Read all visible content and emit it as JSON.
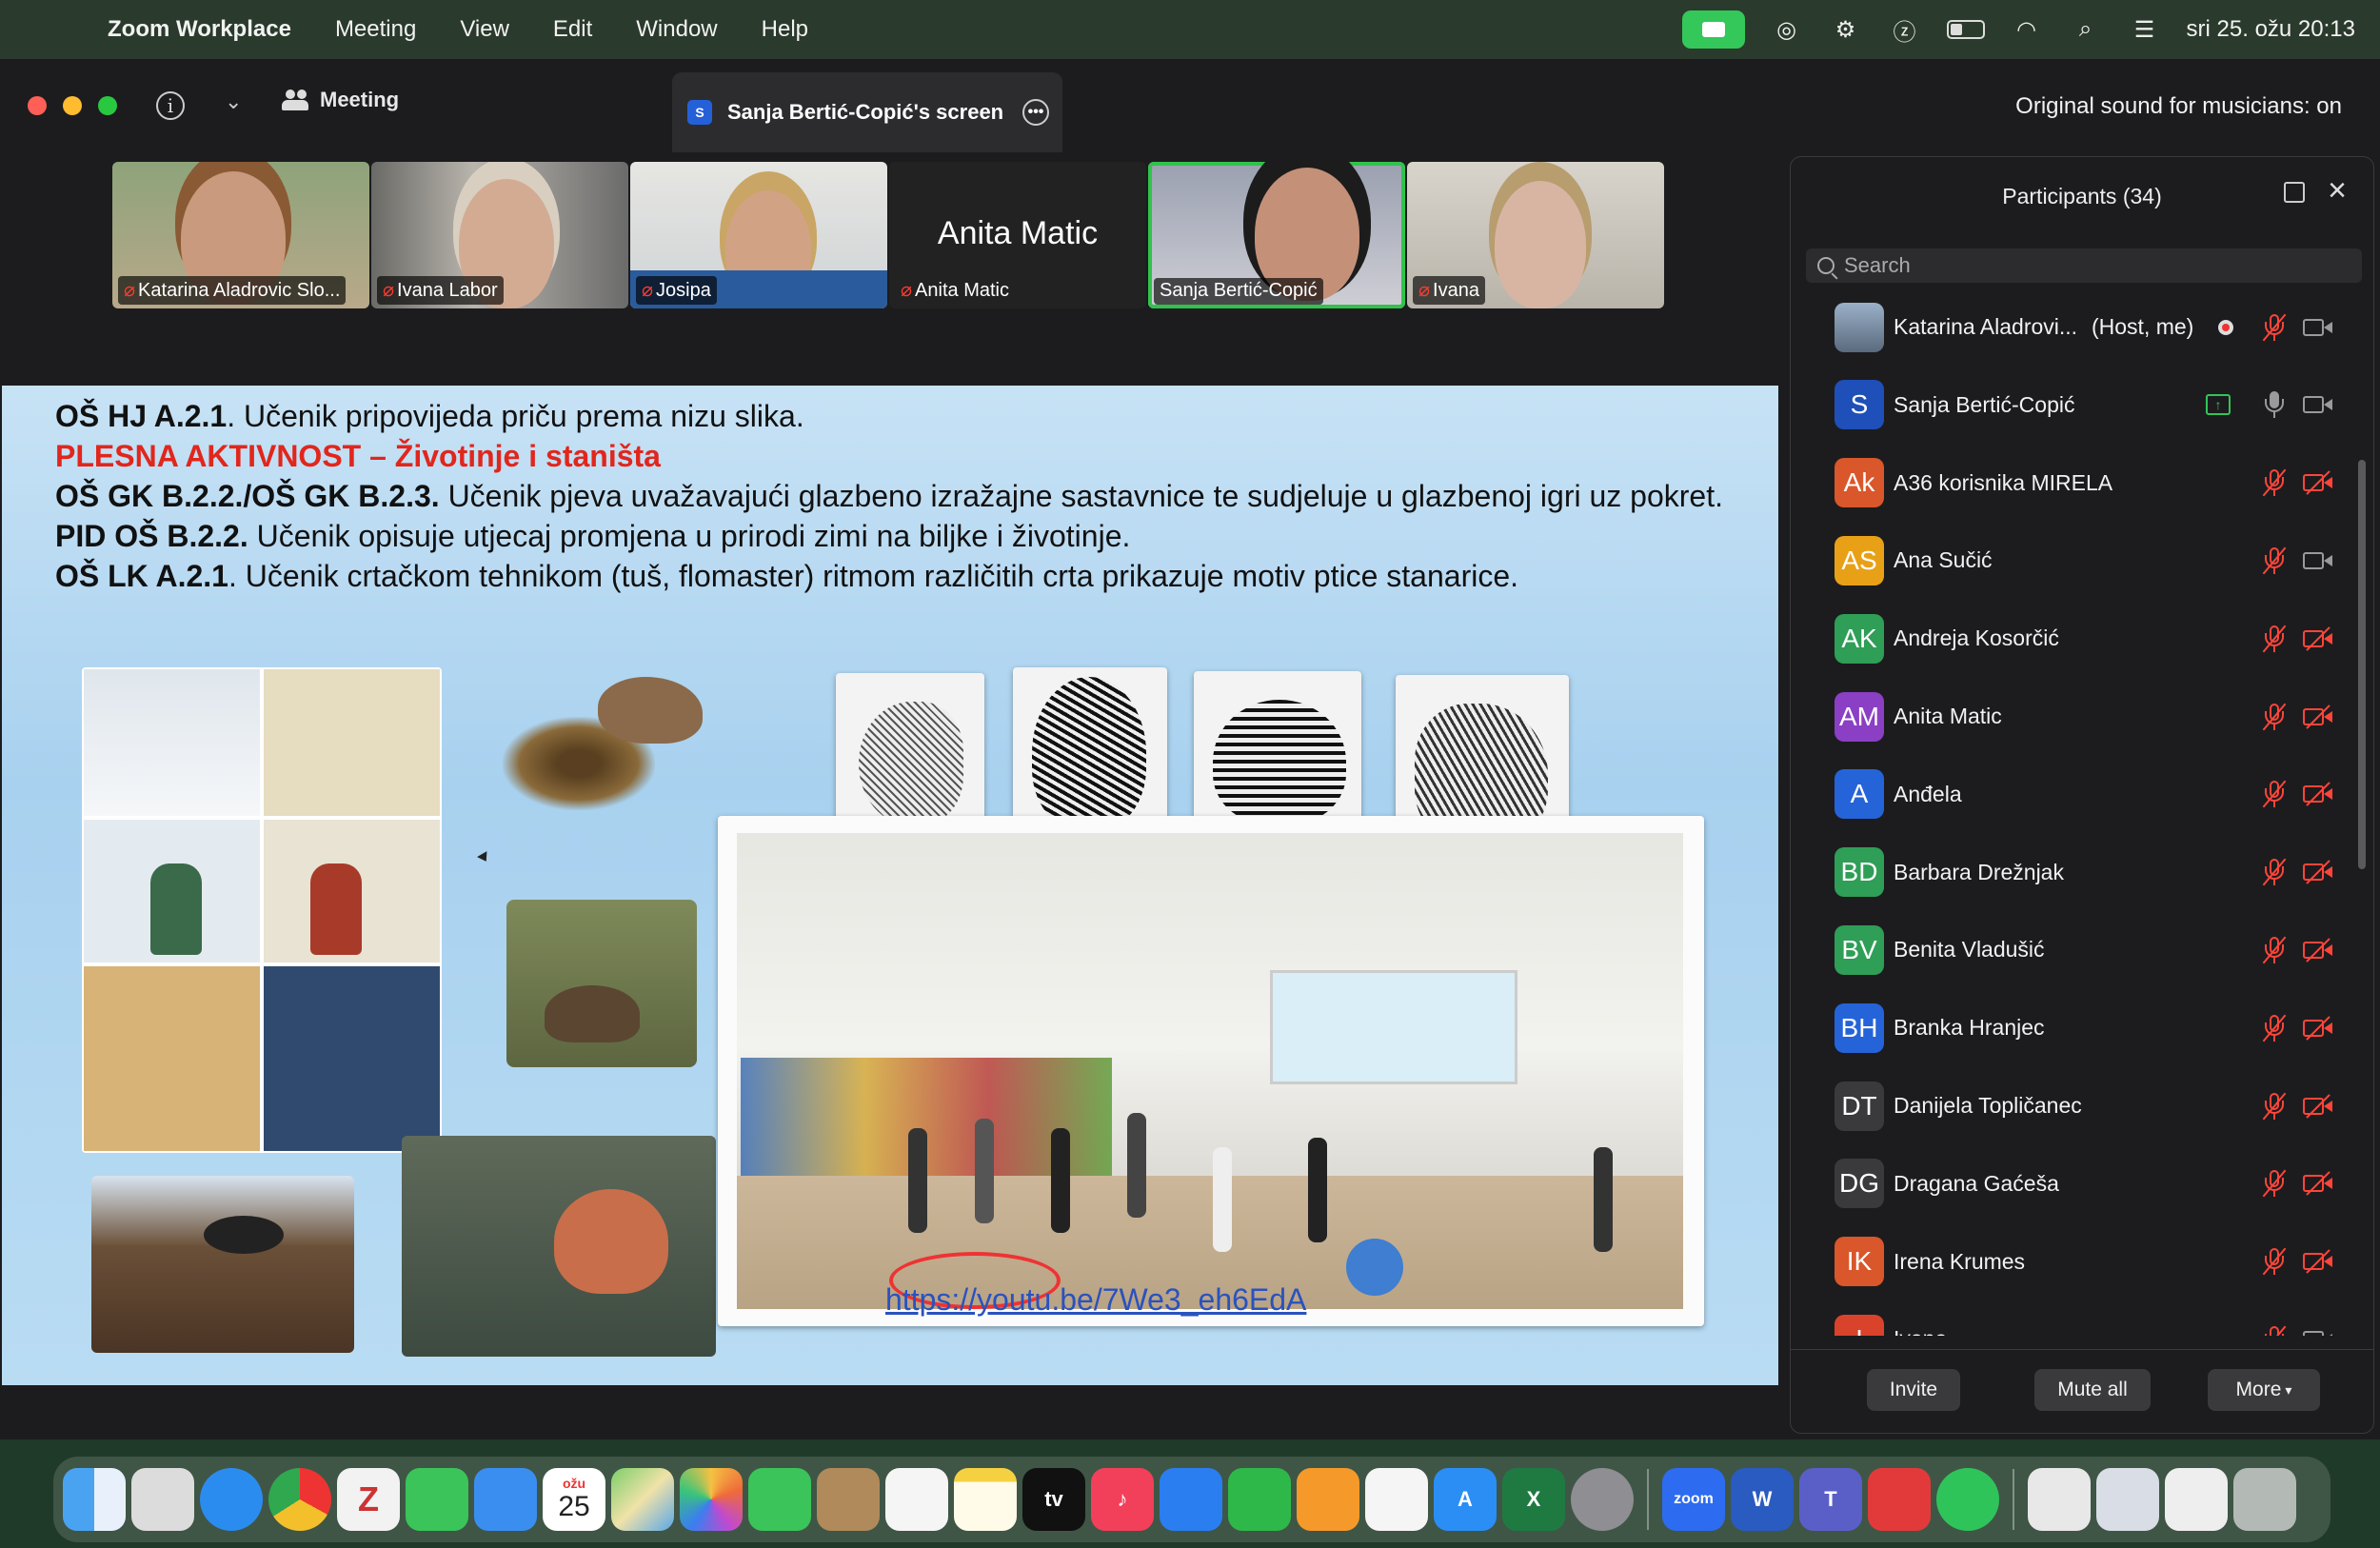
{
  "menubar": {
    "app": "Zoom Workplace",
    "items": [
      "Meeting",
      "View",
      "Edit",
      "Window",
      "Help"
    ],
    "datetime": "sri 25. ožu  20:13"
  },
  "window": {
    "meeting_tab": "Meeting",
    "screen_tab": "Sanja Bertić-Copić's screen",
    "screen_tab_badge": "S",
    "original_sound": "Original sound for musicians: on"
  },
  "thumbnails": [
    {
      "name": "Katarina Aladrovic Slo...",
      "muted": true
    },
    {
      "name": "Ivana Labor",
      "muted": true
    },
    {
      "name": "Josipa",
      "muted": true
    },
    {
      "name": "Anita Matic",
      "muted": true,
      "video_off_label": "Anita Matic"
    },
    {
      "name": "Sanja Bertić-Copić",
      "muted": false,
      "active": true
    },
    {
      "name": "Ivana",
      "muted": true
    }
  ],
  "slide": {
    "line1_bold": "OŠ HJ A.2.1",
    "line1_rest": ". Učenik pripovijeda priču prema nizu slika.",
    "line2": "PLESNA AKTIVNOST – Životinje i staništa",
    "line3_bold": "OŠ GK B.2.2./OŠ GK B.2.3.",
    "line3_rest": "  Učenik pjeva uvažavajući glazbeno izražajne sastavnice te sudjeluje u glazbenoj igri uz pokret.",
    "line4_bold": "PID OŠ B.2.2.",
    "line4_rest": " Učenik opisuje utjecaj promjena u prirodi zimi na biljke i životinje.",
    "line5_bold": "OŠ LK A.2.1",
    "line5_rest": ". Učenik crtačkom tehnikom (tuš, flomaster) ritmom različitih crta prikazuje motiv ptice stanarice.",
    "link": "https://youtu.be/7We3_eh6EdA"
  },
  "participants": {
    "title": "Participants (34)",
    "search_placeholder": "Search",
    "list": [
      {
        "initials": "",
        "name": "Katarina Aladrovi...",
        "tag": "(Host, me)",
        "color": "#6b7f9a",
        "mic": "muted",
        "cam": "on",
        "recording": true
      },
      {
        "initials": "S",
        "name": "Sanja Bertić-Copić",
        "tag": "",
        "color": "#1f4fb8",
        "mic": "on",
        "cam": "on",
        "sharing": true
      },
      {
        "initials": "Ak",
        "name": "A36 korisnika MIRELA",
        "tag": "",
        "color": "#d9572b",
        "mic": "muted",
        "cam": "off"
      },
      {
        "initials": "AS",
        "name": "Ana Sučić",
        "tag": "",
        "color": "#e8a117",
        "mic": "muted",
        "cam": "on"
      },
      {
        "initials": "AK",
        "name": "Andreja Kosorčić",
        "tag": "",
        "color": "#2f9e57",
        "mic": "muted",
        "cam": "off"
      },
      {
        "initials": "AM",
        "name": "Anita Matic",
        "tag": "",
        "color": "#8a3fc4",
        "mic": "muted",
        "cam": "off"
      },
      {
        "initials": "A",
        "name": "Anđela",
        "tag": "",
        "color": "#2563d9",
        "mic": "muted",
        "cam": "off"
      },
      {
        "initials": "BD",
        "name": "Barbara Drežnjak",
        "tag": "",
        "color": "#2f9e57",
        "mic": "muted",
        "cam": "off"
      },
      {
        "initials": "BV",
        "name": "Benita Vladušić",
        "tag": "",
        "color": "#2f9e57",
        "mic": "muted",
        "cam": "off"
      },
      {
        "initials": "BH",
        "name": "Branka Hranjec",
        "tag": "",
        "color": "#2563d9",
        "mic": "muted",
        "cam": "off"
      },
      {
        "initials": "DT",
        "name": "Danijela Topličanec",
        "tag": "",
        "color": "#3a3a3c",
        "mic": "muted",
        "cam": "off"
      },
      {
        "initials": "DG",
        "name": "Dragana Gaćeša",
        "tag": "",
        "color": "#3a3a3c",
        "mic": "muted",
        "cam": "off"
      },
      {
        "initials": "IK",
        "name": "Irena Krumes",
        "tag": "",
        "color": "#d9572b",
        "mic": "muted",
        "cam": "off"
      },
      {
        "initials": "I",
        "name": "Ivana",
        "tag": "",
        "color": "#d9432b",
        "mic": "muted",
        "cam": "on"
      }
    ],
    "buttons": {
      "invite": "Invite",
      "mute_all": "Mute all",
      "more": "More"
    }
  },
  "dock": {
    "calendar_month": "ožu",
    "calendar_day": "25",
    "zoom_label": "zoom",
    "tv_label": "tv"
  }
}
